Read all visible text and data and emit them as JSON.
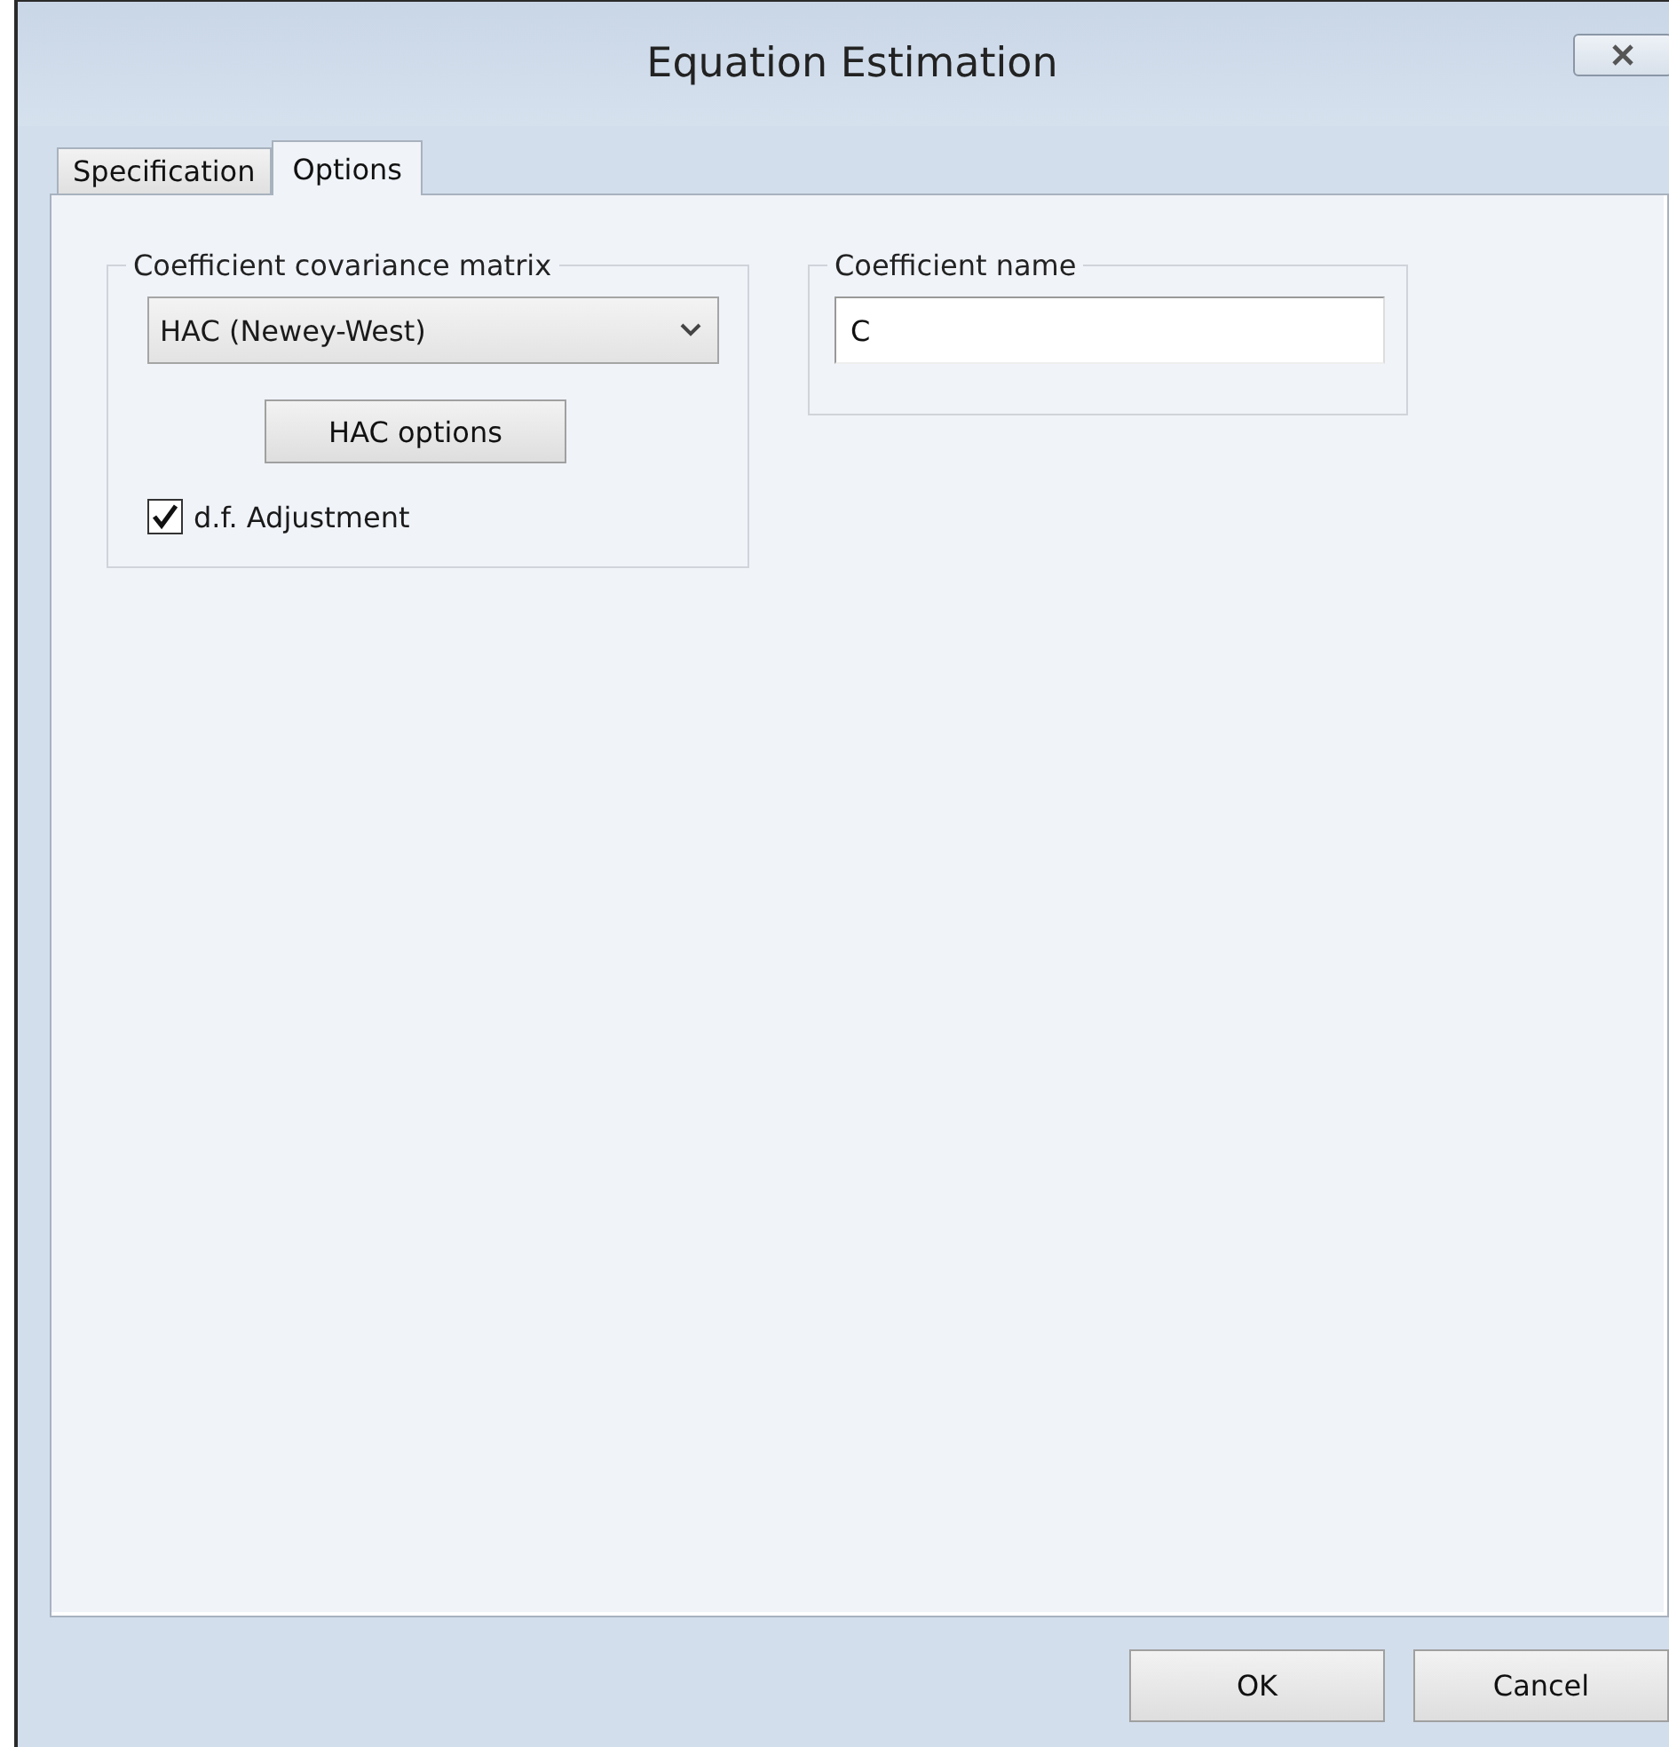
{
  "window": {
    "title": "Equation Estimation"
  },
  "tabs": [
    {
      "label": "Specification",
      "selected": false
    },
    {
      "label": "Options",
      "selected": true
    }
  ],
  "covariance": {
    "label": "Coefficient covariance matrix",
    "method": "HAC (Newey-West)",
    "options_button": "HAC options",
    "df_adjustment": {
      "label": "d.f. Adjustment",
      "checked": true
    }
  },
  "coefficient_name": {
    "label": "Coefficient name",
    "value": "C"
  },
  "buttons": [
    "OK",
    "Cancel"
  ]
}
